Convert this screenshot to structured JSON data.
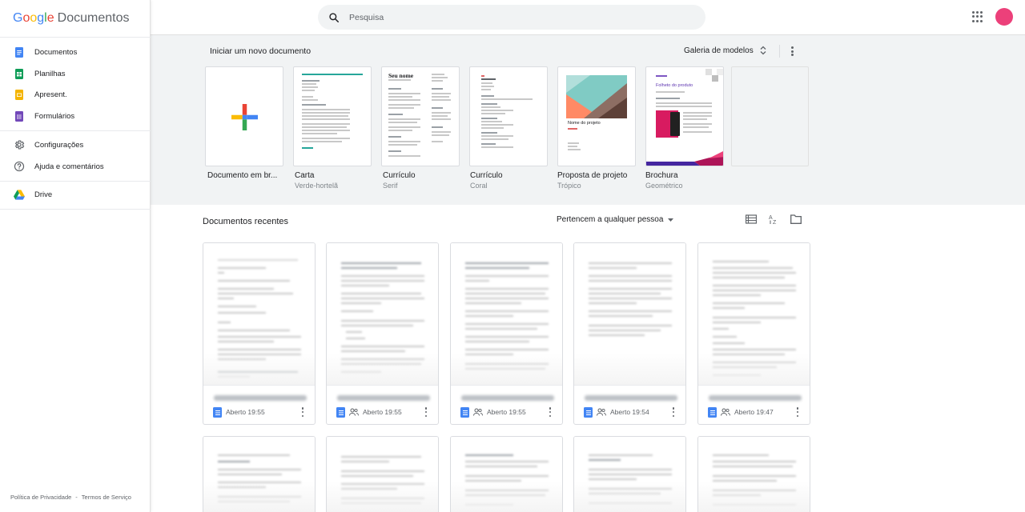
{
  "app": {
    "logo_google": "Google",
    "logo_product": "Documentos"
  },
  "sidebar": {
    "items": [
      {
        "label": "Documentos",
        "icon": "docs-icon",
        "color": "#4285f4"
      },
      {
        "label": "Planilhas",
        "icon": "sheets-icon",
        "color": "#0f9d58"
      },
      {
        "label": "Apresent.",
        "icon": "slides-icon",
        "color": "#f4b400"
      },
      {
        "label": "Formulários",
        "icon": "forms-icon",
        "color": "#7248b9"
      },
      {
        "label": "Configurações",
        "icon": "gear-icon"
      },
      {
        "label": "Ajuda e comentários",
        "icon": "help-icon"
      },
      {
        "label": "Drive",
        "icon": "drive-icon"
      }
    ],
    "footer": {
      "privacy": "Política de Privacidade",
      "separator": "-",
      "terms": "Termos de Serviço"
    }
  },
  "topbar": {
    "search_placeholder": "Pesquisa",
    "avatar_color": "#ec407a"
  },
  "templates": {
    "heading": "Iniciar um novo documento",
    "gallery_label": "Galeria de modelos",
    "items": [
      {
        "name": "Documento em br...",
        "sub": ""
      },
      {
        "name": "Carta",
        "sub": "Verde-hortelã"
      },
      {
        "name": "Currículo",
        "sub": "Serif"
      },
      {
        "name": "Currículo",
        "sub": "Coral"
      },
      {
        "name": "Proposta de projeto",
        "sub": "Trópico"
      },
      {
        "name": "Brochura",
        "sub": "Geométrico"
      }
    ],
    "serif_heading": "Seu nome",
    "project_heading": "Nome do projeto",
    "brochure_heading": "Folheto do produto"
  },
  "recent": {
    "heading": "Documentos recentes",
    "owner_filter": "Pertencem a qualquer pessoa",
    "docs": [
      {
        "opened": "Aberto 19:55",
        "shared": false
      },
      {
        "opened": "Aberto 19:55",
        "shared": true
      },
      {
        "opened": "Aberto 19:55",
        "shared": true
      },
      {
        "opened": "Aberto 19:54",
        "shared": true
      },
      {
        "opened": "Aberto 19:47",
        "shared": true
      }
    ]
  }
}
